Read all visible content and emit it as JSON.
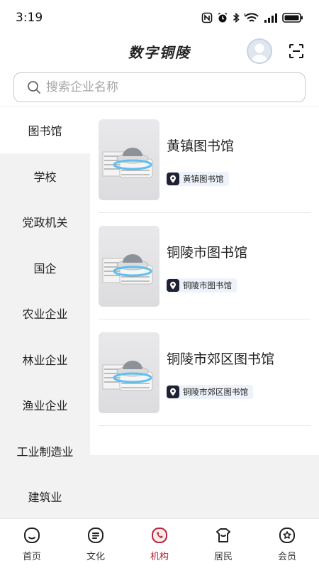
{
  "status_bar": {
    "time": "3:19"
  },
  "header": {
    "title": "数字铜陵"
  },
  "search": {
    "placeholder": "搜索企业名称"
  },
  "sidebar": {
    "items": [
      {
        "label": "图书馆",
        "active": true
      },
      {
        "label": "学校"
      },
      {
        "label": "党政机关"
      },
      {
        "label": "国企"
      },
      {
        "label": "农业企业"
      },
      {
        "label": "林业企业"
      },
      {
        "label": "渔业企业"
      },
      {
        "label": "工业制造业"
      },
      {
        "label": "建筑业"
      }
    ]
  },
  "cards": [
    {
      "title": "黄镇图书馆",
      "tag": "黄镇图书馆"
    },
    {
      "title": "铜陵市图书馆",
      "tag": "铜陵市图书馆"
    },
    {
      "title": "铜陵市郊区图书馆",
      "tag": "铜陵市郊区图书馆"
    }
  ],
  "bottom_nav": {
    "items": [
      {
        "label": "首页",
        "icon": "home-icon"
      },
      {
        "label": "文化",
        "icon": "culture-icon"
      },
      {
        "label": "机构",
        "icon": "institution-icon",
        "active": true
      },
      {
        "label": "居民",
        "icon": "resident-icon"
      },
      {
        "label": "会员",
        "icon": "member-icon"
      }
    ]
  },
  "colors": {
    "accent": "#b3283a",
    "sidebar_bg": "#f2f2f2",
    "tag_bg": "#eef3fb"
  }
}
